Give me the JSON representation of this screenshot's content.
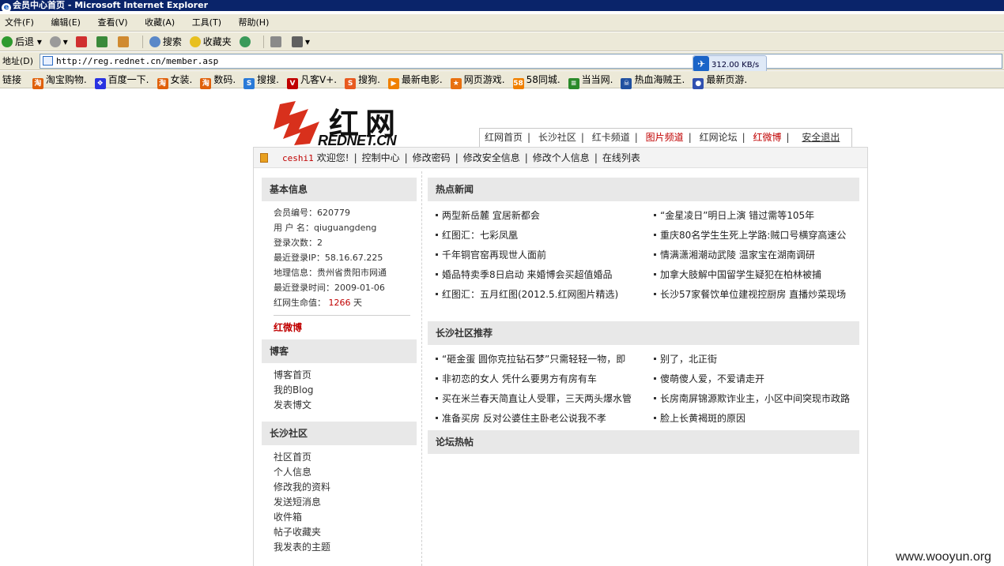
{
  "window": {
    "title": "会员中心首页 - Microsoft Internet Explorer"
  },
  "menu": [
    "文件(F)",
    "编辑(E)",
    "查看(V)",
    "收藏(A)",
    "工具(T)",
    "帮助(H)"
  ],
  "toolbar": {
    "back": "后退",
    "search": "搜索",
    "favorites": "收藏夹"
  },
  "address": {
    "label": "地址(D)",
    "url": "http://reg.rednet.cn/member.asp"
  },
  "download_speed": "312.00 KB/s",
  "links_bar": {
    "label": "链接",
    "items": [
      "淘宝购物.",
      "百度一下.",
      "女装.",
      "数码.",
      "搜搜.",
      "凡客V+.",
      "搜狗.",
      "最新电影.",
      "网页游戏.",
      "58同城.",
      "当当网.",
      "热血海贼王.",
      "最新页游."
    ],
    "icons": [
      {
        "name": "taobao-icon",
        "color": "#e0600a",
        "glyph": "淘"
      },
      {
        "name": "baidu-icon",
        "color": "#2932e1",
        "glyph": "❖"
      },
      {
        "name": "taobao-icon",
        "color": "#e0600a",
        "glyph": "淘"
      },
      {
        "name": "taobao-icon",
        "color": "#e0600a",
        "glyph": "淘"
      },
      {
        "name": "soso-icon",
        "color": "#2a7ad8",
        "glyph": "S"
      },
      {
        "name": "vancl-icon",
        "color": "#c00000",
        "glyph": "V"
      },
      {
        "name": "sogou-icon",
        "color": "#e85a20",
        "glyph": "S"
      },
      {
        "name": "movie-icon",
        "color": "#f08000",
        "glyph": "▶"
      },
      {
        "name": "game-icon",
        "color": "#e87010",
        "glyph": "★"
      },
      {
        "name": "58-icon",
        "color": "#f08000",
        "glyph": "58"
      },
      {
        "name": "dangdang-icon",
        "color": "#2a8a2a",
        "glyph": "≡"
      },
      {
        "name": "onepiece-icon",
        "color": "#2050a0",
        "glyph": "☠"
      },
      {
        "name": "webgame-icon",
        "color": "#3050b0",
        "glyph": "●"
      }
    ]
  },
  "logo": {
    "cn": "红网",
    "en": "REDNET.CN"
  },
  "topnav": [
    {
      "label": "红网首页",
      "red": false
    },
    {
      "label": "长沙社区",
      "red": false
    },
    {
      "label": "红卡频道",
      "red": false
    },
    {
      "label": "图片频道",
      "red": true
    },
    {
      "label": "红网论坛",
      "red": false
    },
    {
      "label": "红微博",
      "red": true
    }
  ],
  "logout": "安全退出",
  "userbar": {
    "username": "ceshi1",
    "welcome": "欢迎您!",
    "links": [
      "控制中心",
      "修改密码",
      "修改安全信息",
      "修改个人信息",
      "在线列表"
    ]
  },
  "basic_info": {
    "title": "基本信息",
    "lines": [
      {
        "label": "会员编号：",
        "value": "620779"
      },
      {
        "label": "用 户 名：",
        "value": "qiuguangdeng"
      },
      {
        "label": "登录次数：",
        "value": "2"
      },
      {
        "label": "最近登录IP：",
        "value": "58.16.67.225"
      },
      {
        "label": "地理信息：",
        "value": "贵州省贵阳市网通"
      },
      {
        "label": "最近登录时间：",
        "value": "2009-01-06"
      }
    ],
    "life_label": "红网生命值：",
    "life_value": "1266",
    "life_unit": "天",
    "weibo": "红微博"
  },
  "blog": {
    "title": "博客",
    "links": [
      "博客首页",
      "我的Blog",
      "发表博文"
    ]
  },
  "community": {
    "title": "长沙社区",
    "links": [
      "社区首页",
      "个人信息",
      "修改我的资料",
      "发送短消息",
      "收件箱",
      "帖子收藏夹",
      "我发表的主题"
    ]
  },
  "hot_news": {
    "title": "热点新闻",
    "left": [
      "两型新岳麓 宜居新都会",
      "红图汇：七彩凤凰",
      "千年铜官窑再现世人面前",
      "婚品特卖季8日启动 来婚博会买超值婚品",
      "红图汇：五月红图(2012.5.红网图片精选)"
    ],
    "right": [
      "“金星凌日”明日上演 错过需等105年",
      "重庆80名学生生死上学路:贼口号横穿高速公",
      "情满潇湘潮动武陵 温家宝在湖南调研",
      "加拿大肢解中国留学生疑犯在柏林被捕",
      "长沙57家餐饮单位建视控厨房 直播炒菜现场"
    ]
  },
  "community_rec": {
    "title": "长沙社区推荐",
    "left": [
      "“砸金蛋 圆你克拉钻石梦”只需轻轻一物，即",
      "非初恋的女人 凭什么要男方有房有车",
      "买在米兰春天简直让人受罪，三天两头爆水管",
      "准备买房 反对公婆住主卧老公说我不孝"
    ],
    "right": [
      "别了，北正街",
      "傻萌傻人爱，不爱请走开",
      "长房南屏锦源欺诈业主，小区中间突现市政路",
      "脸上长黄褐斑的原因"
    ]
  },
  "forum_hot": {
    "title": "论坛热帖"
  },
  "watermark": "www.wooyun.org"
}
